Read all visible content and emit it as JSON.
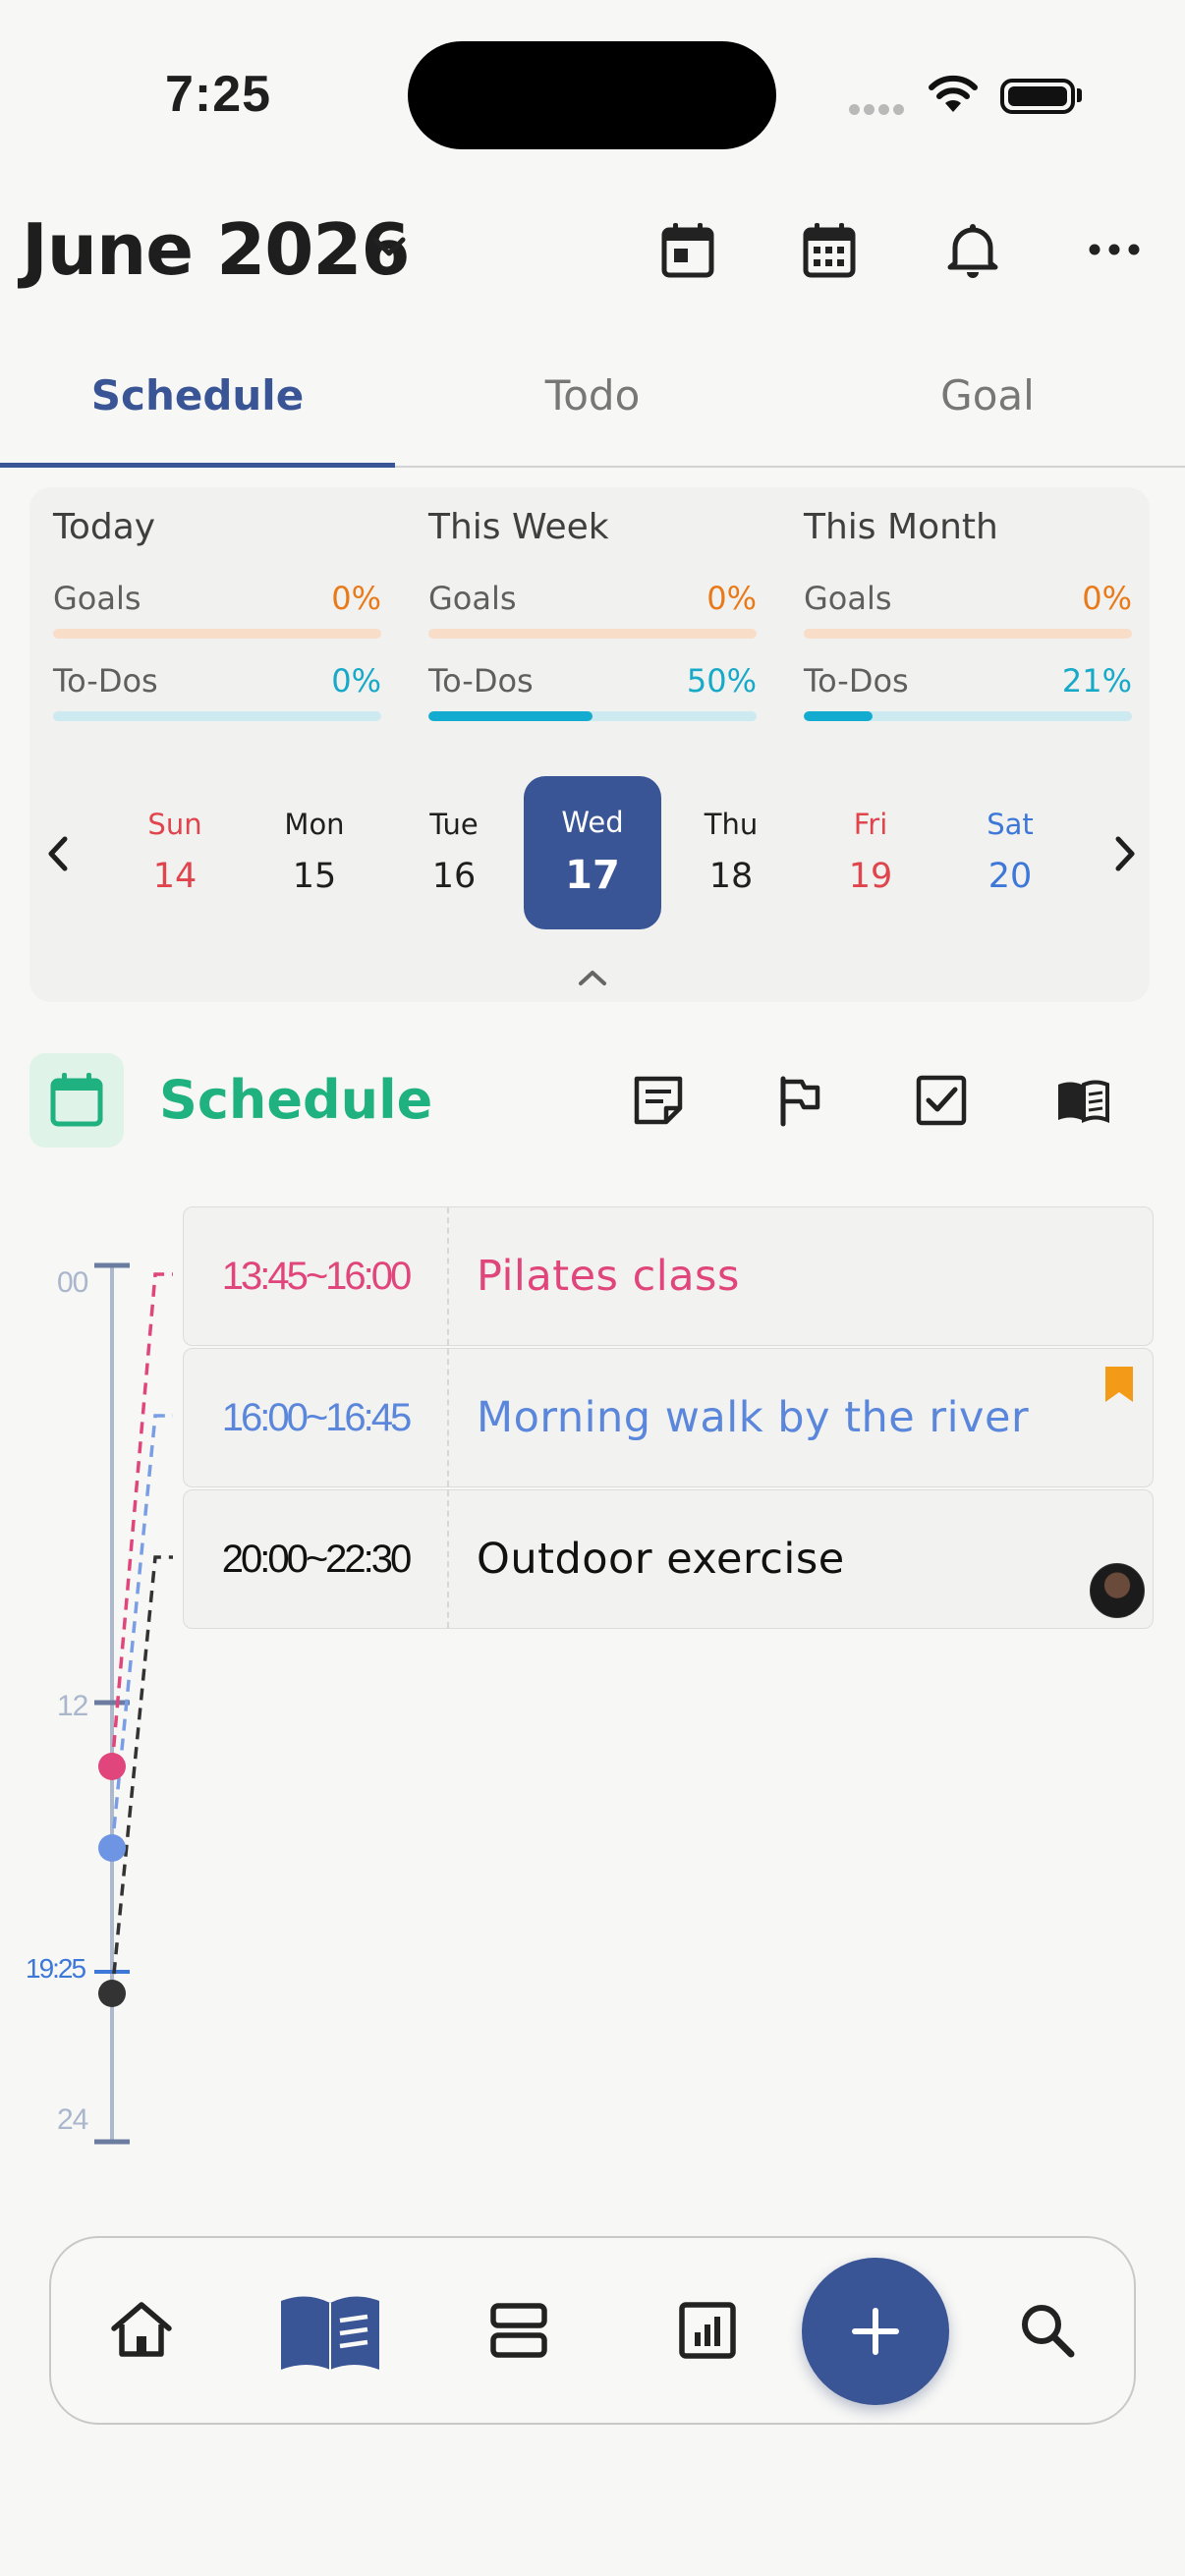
{
  "status_bar": {
    "time": "7:25"
  },
  "header": {
    "title": "June 2026"
  },
  "tabs": [
    {
      "label": "Schedule",
      "active": true
    },
    {
      "label": "Todo",
      "active": false
    },
    {
      "label": "Goal",
      "active": false
    }
  ],
  "summary": [
    {
      "title": "Today",
      "goals_label": "Goals",
      "goals_pct": "0%",
      "goals_value": 0,
      "todos_label": "To-Dos",
      "todos_pct": "0%",
      "todos_value": 0
    },
    {
      "title": "This Week",
      "goals_label": "Goals",
      "goals_pct": "0%",
      "goals_value": 0,
      "todos_label": "To-Dos",
      "todos_pct": "50%",
      "todos_value": 50
    },
    {
      "title": "This Month",
      "goals_label": "Goals",
      "goals_pct": "0%",
      "goals_value": 0,
      "todos_label": "To-Dos",
      "todos_pct": "21%",
      "todos_value": 21
    }
  ],
  "week": [
    {
      "name": "Sun",
      "date": "14",
      "color": "red"
    },
    {
      "name": "Mon",
      "date": "15",
      "color": ""
    },
    {
      "name": "Tue",
      "date": "16",
      "color": ""
    },
    {
      "name": "Wed",
      "date": "17",
      "color": "",
      "selected": true
    },
    {
      "name": "Thu",
      "date": "18",
      "color": ""
    },
    {
      "name": "Fri",
      "date": "19",
      "color": "red"
    },
    {
      "name": "Sat",
      "date": "20",
      "color": "blue"
    }
  ],
  "schedule": {
    "title": "Schedule"
  },
  "timeline": {
    "tick_00": "00",
    "tick_12": "12",
    "tick_24": "24",
    "now": "19:25"
  },
  "events": [
    {
      "time": "13:45~16:00",
      "title": "Pilates class",
      "color": "#e0457b"
    },
    {
      "time": "16:00~16:45",
      "title": "Morning walk by the river",
      "color": "#5a86db"
    },
    {
      "time": "20:00~22:30",
      "title": "Outdoor exercise",
      "color": "#111111"
    }
  ],
  "colors": {
    "accent": "#3a5595",
    "schedule_green": "#1fb17f",
    "goal_orange": "#e97a1a",
    "todo_cyan": "#13acd0"
  }
}
